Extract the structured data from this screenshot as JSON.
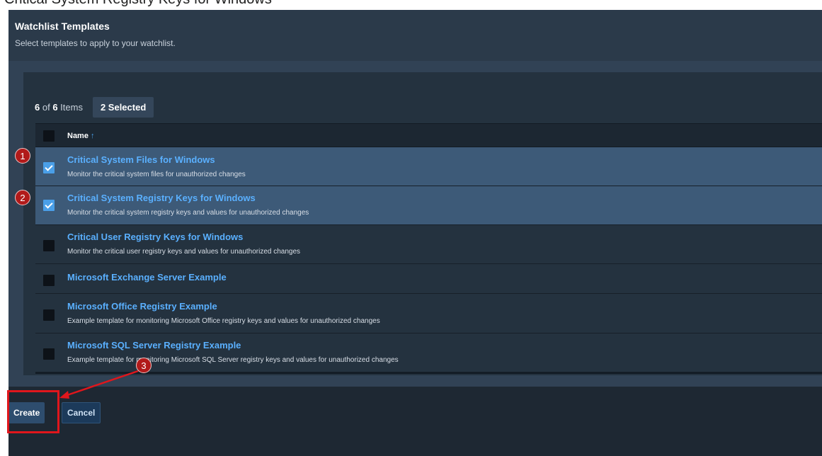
{
  "page_heading": "Critical System Registry Keys for Windows",
  "dialog": {
    "title": "Watchlist Templates",
    "subtitle": "Select templates to apply to your watchlist."
  },
  "summary": {
    "shown": "6",
    "of": " of ",
    "total": "6",
    "items_label": " Items",
    "selected_label": "2 Selected"
  },
  "grid": {
    "column_name": "Name",
    "sort_indicator": "↑",
    "rows": [
      {
        "title": "Critical System Files for Windows",
        "description": "Monitor the critical system files for unauthorized changes",
        "checked": true
      },
      {
        "title": "Critical System Registry Keys for Windows",
        "description": "Monitor the critical system registry keys and values for unauthorized changes",
        "checked": true
      },
      {
        "title": "Critical User Registry Keys for Windows",
        "description": "Monitor the critical user registry keys and values for unauthorized changes",
        "checked": false
      },
      {
        "title": "Microsoft Exchange Server Example",
        "description": "",
        "checked": false
      },
      {
        "title": "Microsoft Office Registry Example",
        "description": "Example template for monitoring Microsoft Office registry keys and values for unauthorized changes",
        "checked": false
      },
      {
        "title": "Microsoft SQL Server Registry Example",
        "description": "Example template for monitoring Microsoft SQL Server registry keys and values for unauthorized changes",
        "checked": false
      }
    ]
  },
  "footer": {
    "create_label": "Create",
    "cancel_label": "Cancel"
  },
  "annotations": {
    "step1": "1",
    "step2": "2",
    "step3": "3"
  },
  "colors": {
    "accent": "#4a9fe8",
    "link": "#5ab0ff",
    "annotation_red": "#e0161c"
  }
}
